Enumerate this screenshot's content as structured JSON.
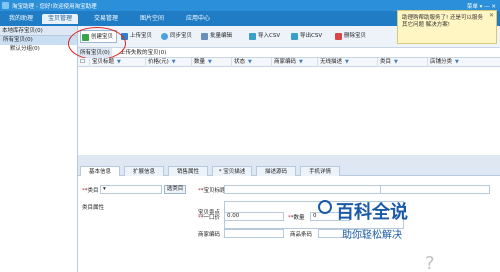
{
  "window": {
    "title": "淘宝助理 - 您好!欢迎使用淘宝助理",
    "menu": "菜单 ▾",
    "win_controls": "— ✕"
  },
  "nav": {
    "items": [
      {
        "label": "我的助理",
        "active": false
      },
      {
        "label": "宝贝管理",
        "active": true
      },
      {
        "label": "交易管理",
        "active": false
      },
      {
        "label": "图片空间",
        "active": false
      },
      {
        "label": "应用中心",
        "active": false
      }
    ]
  },
  "left_panel": {
    "header": "本地库存宝贝(0)",
    "tree": [
      {
        "label": "所有宝贝(0)",
        "selected": true
      },
      {
        "label": "默认分组(0)",
        "selected": false
      }
    ]
  },
  "toolbar": {
    "create": "创建宝贝",
    "upload": "上传宝贝",
    "sync": "同步宝贝",
    "batch_edit": "批量编辑",
    "import_csv": "导入CSV",
    "export_csv": "导出CSV",
    "delete": "删除宝贝"
  },
  "subtabs": [
    {
      "label": "所有宝贝(0)",
      "active": true
    },
    {
      "label": "上传失败的宝贝(0)",
      "active": false
    }
  ],
  "grid": {
    "columns": [
      "宝贝标题",
      "价格(元)",
      "数量",
      "状态",
      "商家编码",
      "无线描述",
      "类目",
      "店铺分类"
    ]
  },
  "detail_tabs": [
    {
      "label": "基本信息",
      "active": true
    },
    {
      "label": "扩展信息",
      "active": false
    },
    {
      "label": "销售属性",
      "active": false
    },
    {
      "label": "* 宝贝描述",
      "active": false
    },
    {
      "label": "描述源码",
      "active": false
    },
    {
      "label": "手机详情",
      "active": false
    }
  ],
  "form": {
    "category_label": "*类目",
    "select_category": "选类目",
    "attributes_label": "类目属性",
    "title_label": "*宝贝标题",
    "selling_point_label": "宝贝卖点",
    "price_label": "*一口价",
    "price_value": "0.00",
    "qty_label": "*数量",
    "qty_value": "0",
    "merchant_code_label": "商家编码",
    "barcode_label": "商品条码"
  },
  "tooltip": {
    "text": "助理购帮助服务了! 还是可以服务其它问题 解决方案!",
    "close": "✕"
  },
  "watermark": {
    "main": "百科全说",
    "sub": "助你轻松解决"
  },
  "placeholder_glyph": "?"
}
